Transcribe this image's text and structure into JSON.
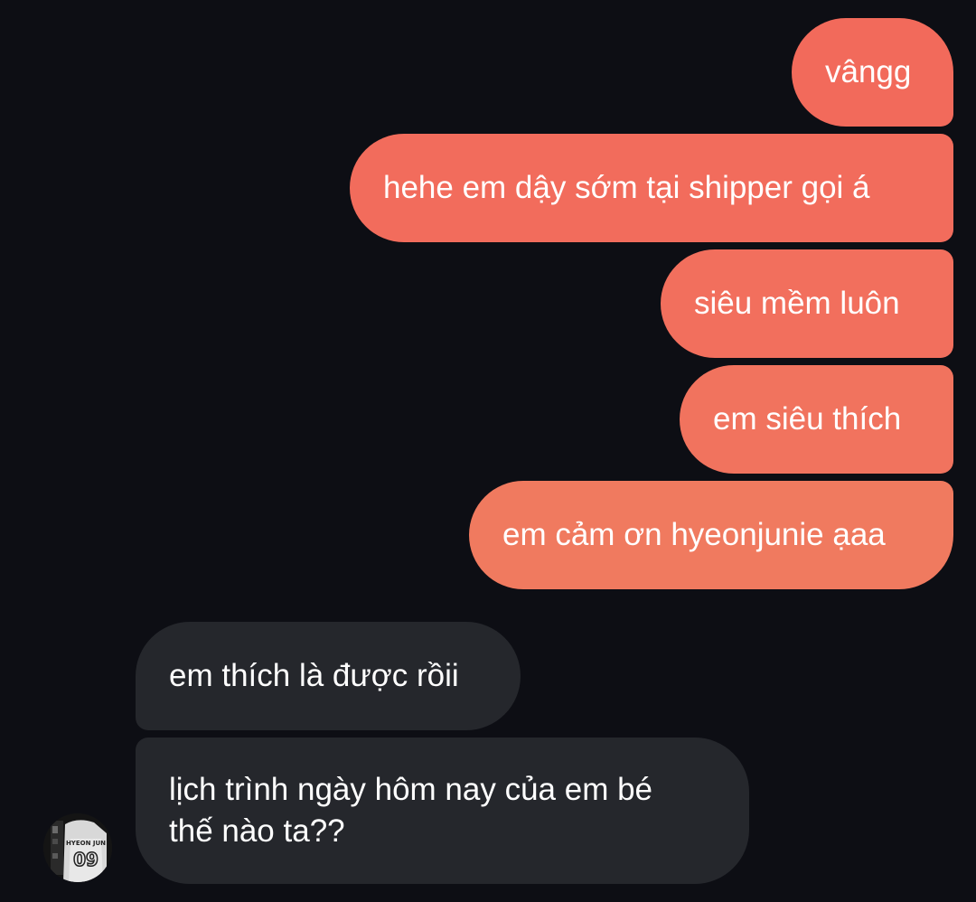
{
  "conversation": {
    "outgoing": [
      {
        "text": "vângg",
        "color": "#f26a5b"
      },
      {
        "text": "hehe em dậy sớm tại shipper gọi á",
        "color": "#f26c5c"
      },
      {
        "text": "siêu mềm luôn",
        "color": "#f26f5d"
      },
      {
        "text": "em siêu thích",
        "color": "#f1735e"
      },
      {
        "text": "em cảm ơn hyeonjunie ạaa",
        "color": "#f07a5f"
      }
    ],
    "incoming": [
      {
        "text": "em thích là được rồii"
      },
      {
        "text_line1": "lịch trình ngày hôm nay của em bé",
        "text_line2": "thế nào ta??"
      }
    ],
    "avatar": {
      "label_top": "HYEON JUN",
      "label_number": "09"
    }
  }
}
